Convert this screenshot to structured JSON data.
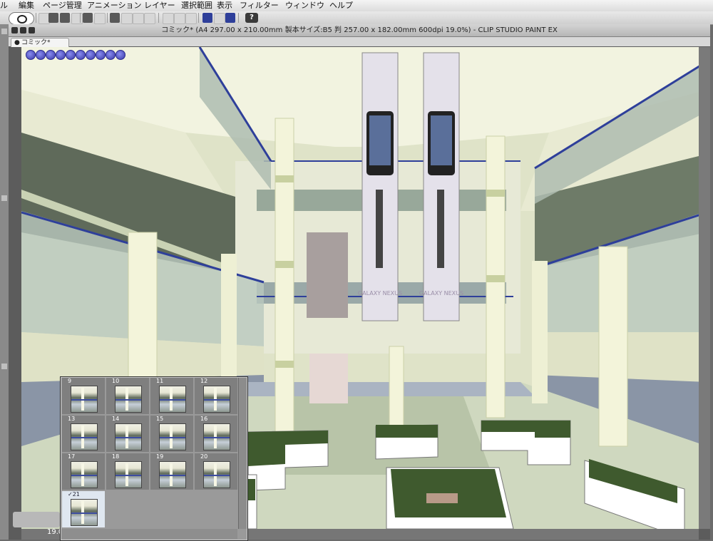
{
  "menu": [
    "ル",
    "編集",
    "ページ管理",
    "アニメーション",
    "レイヤー",
    "選択範囲",
    "表示",
    "フィルター",
    "ウィンドウ",
    "ヘルプ"
  ],
  "toolbar": {
    "help_label": "?"
  },
  "window": {
    "title": "コミック* (A4 297.00 x 210.00mm 製本サイズ:B5 判 257.00 x 182.00mm 600dpi 19.0%)  - CLIP STUDIO PAINT EX",
    "tab_label": "コミック*",
    "tab_close": "●"
  },
  "canvas": {
    "banner_text_1": "GALAXY NEXUS",
    "banner_text_2": "GALAXY NEXUS"
  },
  "page_panel": {
    "pages": [
      "9",
      "10",
      "11",
      "12",
      "13",
      "14",
      "15",
      "16",
      "17",
      "18",
      "19",
      "20",
      "✓21"
    ],
    "selected": "✓21"
  },
  "status": {
    "zoom": "19.0"
  },
  "colors": {
    "accent": "#2e3f9a",
    "canvas_bg": "#dfe3c8"
  }
}
